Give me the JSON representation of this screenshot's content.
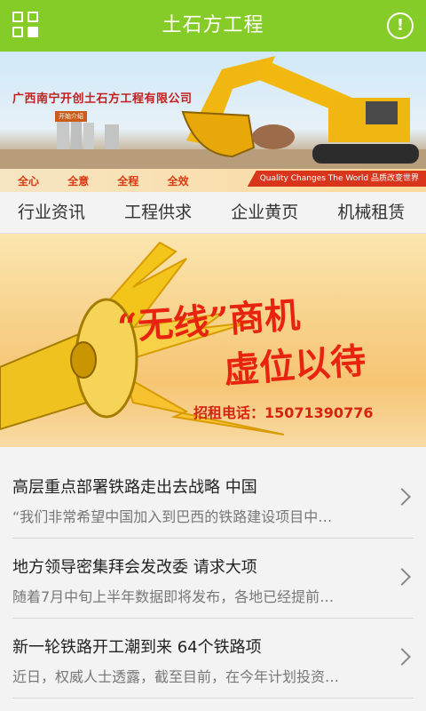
{
  "header": {
    "title": "土石方工程"
  },
  "banner": {
    "company": "广西南宁开创土石方工程有限公司",
    "badge": "开始介绍",
    "slogans": [
      "全心",
      "全意",
      "全程",
      "全效"
    ],
    "tagline": "Quality Changes The World 品质改变世界"
  },
  "tabs": [
    "行业资讯",
    "工程供求",
    "企业黄页",
    "机械租赁"
  ],
  "promo": {
    "line1": "“无线”商机",
    "line2": "虚位以待",
    "phone": "招租电话：15071390776"
  },
  "news": [
    {
      "title": "高层重点部署铁路走出去战略 中国",
      "desc": "“我们非常希望中国加入到巴西的铁路建设项目中…"
    },
    {
      "title": "地方领导密集拜会发改委 请求大项",
      "desc": "随着7月中旬上半年数据即将发布，各地已经提前…"
    },
    {
      "title": "新一轮铁路开工潮到来 64个铁路项",
      "desc": "近日，权威人士透露，截至目前，在今年计划投资…"
    }
  ]
}
